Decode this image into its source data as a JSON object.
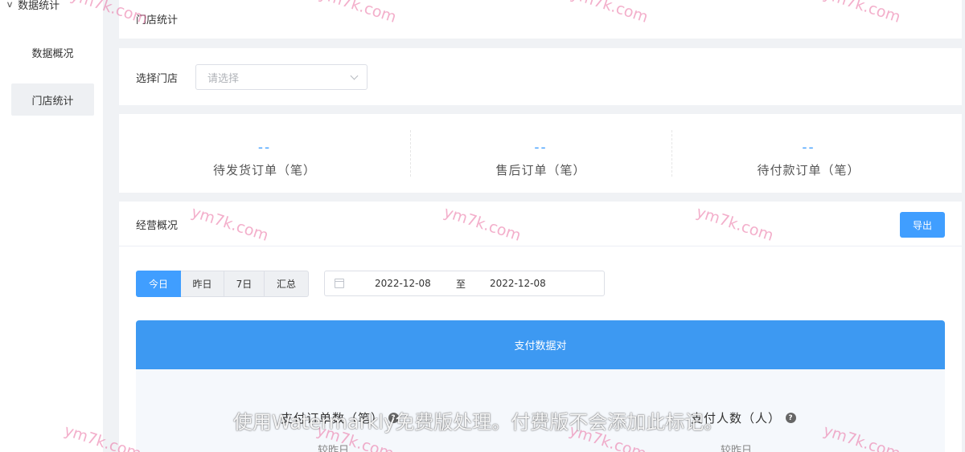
{
  "sidebar": {
    "group_label": "数据统计",
    "items": [
      {
        "label": "数据概况"
      },
      {
        "label": "门店统计"
      }
    ]
  },
  "page": {
    "title": "门店统计"
  },
  "store_select": {
    "label": "选择门店",
    "placeholder": "请选择"
  },
  "stats": [
    {
      "value": "--",
      "label": "待发货订单（笔）"
    },
    {
      "value": "--",
      "label": "售后订单（笔）"
    },
    {
      "value": "--",
      "label": "待付款订单（笔）"
    }
  ],
  "overview": {
    "title": "经营概况",
    "export_label": "导出",
    "tabs": [
      {
        "label": "今日",
        "active": true
      },
      {
        "label": "昨日",
        "active": false
      },
      {
        "label": "7日",
        "active": false
      },
      {
        "label": "汇总",
        "active": false
      }
    ],
    "date_range": {
      "start": "2022-12-08",
      "separator": "至",
      "end": "2022-12-08"
    },
    "payment_header": "支付数据对",
    "metrics": [
      {
        "label": "支付订单数（笔）",
        "sub": "较昨日"
      },
      {
        "label": "支付人数（人）",
        "sub": "较昨日"
      }
    ]
  },
  "watermark_text": "ym7k.com",
  "overlay_notice": "使用Watermarkly免费版处理。付费版不会添加此标记。",
  "colors": {
    "accent": "#409eff",
    "payment_header": "#3d99f2",
    "watermark": "#e96ea0"
  }
}
